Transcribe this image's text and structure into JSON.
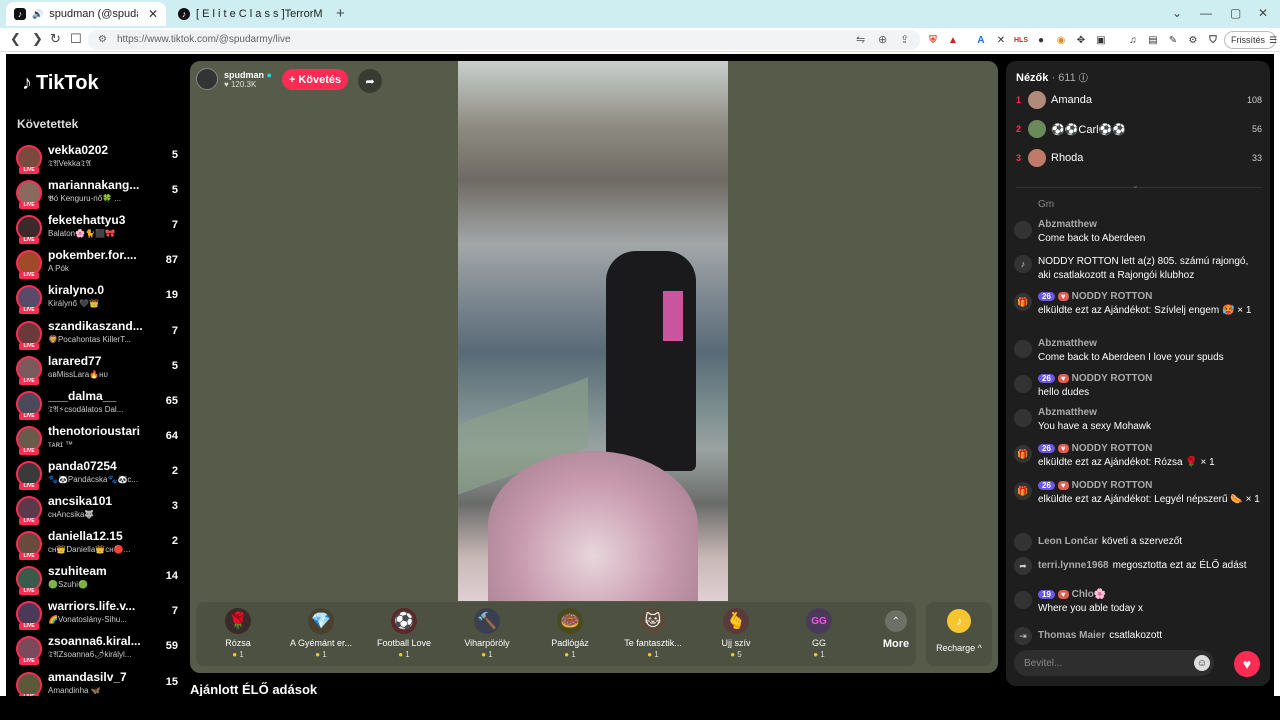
{
  "browser": {
    "tabs": [
      {
        "title": "spudman (@spudarmy) ÉLŐ ...",
        "active": true
      },
      {
        "title": "[ E l i t e  C l a s s ]TerrorMo...",
        "active": false
      }
    ],
    "url": "https://www.tiktok.com/@spudarmy/live",
    "refresh_label": "Frissítés"
  },
  "sidebar": {
    "logo": "TikTok",
    "following_title": "Követettek",
    "live_badge": "LIVE",
    "items": [
      {
        "name": "vekka0202",
        "sub": "𝔗𝔄Vekka𝔗𝔄",
        "count": "5",
        "color": "#7a4a3c"
      },
      {
        "name": "mariannakang...",
        "sub": "𝕭ó Kenguru-nő🍀 ...",
        "count": "5",
        "color": "#8a6a5c"
      },
      {
        "name": "feketehattyu3",
        "sub": "Balaton🌸🐈⬛🎀",
        "count": "7",
        "color": "#3c2a2a"
      },
      {
        "name": "pokember.for....",
        "sub": "A Pók",
        "count": "87",
        "color": "#a04a2a"
      },
      {
        "name": "kiralyno.0",
        "sub": "Királynő 🖤👑",
        "count": "19",
        "color": "#5a4a6a"
      },
      {
        "name": "szandikaszand...",
        "sub": "🦁Pocahontas KillerT...",
        "count": "7",
        "color": "#6a3a3a"
      },
      {
        "name": "larared77",
        "sub": "ɢʙMissLara🔥ʜᴜ",
        "count": "5",
        "color": "#7a5a5a"
      },
      {
        "name": "___dalma__",
        "sub": "𝔗𝔄⚡csodálatos Dal...",
        "count": "65",
        "color": "#4a4a5a"
      },
      {
        "name": "thenotorioustari",
        "sub": "ᴛᴀʀɪ ™",
        "count": "64",
        "color": "#6a5a4a"
      },
      {
        "name": "panda07254",
        "sub": "🐾🐼Pandácska🐾🐼c...",
        "count": "2",
        "color": "#3a3a3a"
      },
      {
        "name": "ancsika101",
        "sub": "ᴄʜAncsika🐺",
        "count": "3",
        "color": "#5a3a4a"
      },
      {
        "name": "daniella12.15",
        "sub": "ᴄʜ👑Daniella👑ᴄʜ🔴...",
        "count": "2",
        "color": "#6a4a3a"
      },
      {
        "name": "szuhiteam",
        "sub": "🟢Szuhi🟢",
        "count": "14",
        "color": "#3a5a4a"
      },
      {
        "name": "warriors.life.v...",
        "sub": "🌈Vonatoslány-Sihu...",
        "count": "7",
        "color": "#4a3a5a"
      },
      {
        "name": "zsoanna6.kiral...",
        "sub": "𝔗𝔄Zsoanna6🌶királyl...",
        "count": "59",
        "color": "#7a4a5a"
      },
      {
        "name": "amandasilv_7",
        "sub": "Amandinha 🦋",
        "count": "15",
        "color": "#5a5a3a"
      }
    ]
  },
  "stage": {
    "host_name": "spudman",
    "host_likes": "120.3K",
    "follow_label": "+ Követés",
    "gifts": [
      {
        "name": "Rózsa",
        "price": "1",
        "icon": "🌹",
        "bg": "#3a2a2a"
      },
      {
        "name": "A Gyémánt er...",
        "price": "1",
        "icon": "💎",
        "bg": "#4a4030"
      },
      {
        "name": "Football Love",
        "price": "1",
        "icon": "⚽",
        "bg": "#5a2a2a"
      },
      {
        "name": "Viharpöröly",
        "price": "1",
        "icon": "🔨",
        "bg": "#3a4050"
      },
      {
        "name": "Padlógáz",
        "price": "1",
        "icon": "🍩",
        "bg": "#4a4a20"
      },
      {
        "name": "Te fantasztik...",
        "price": "1",
        "icon": "🐱",
        "bg": "#5a4a3a"
      },
      {
        "name": "Ujj szív",
        "price": "5",
        "icon": "🫰",
        "bg": "#5a3a3a"
      },
      {
        "name": "GG",
        "price": "1",
        "icon": "GG",
        "bg": "#4a3a5a"
      }
    ],
    "more_label": "More",
    "recharge_label": "Recharge ^",
    "recommended_title": "Ajánlott ÉLŐ adások"
  },
  "rpanel": {
    "viewers_label": "Nézők",
    "viewers_count": "· 611",
    "top_viewers": [
      {
        "rank": "1",
        "name": "Amanda",
        "score": "108",
        "color": "#b08a7a"
      },
      {
        "rank": "2",
        "name": "⚽⚽Carl⚽⚽",
        "score": "56",
        "color": "#6a8a5a"
      },
      {
        "rank": "3",
        "name": "Rhoda",
        "score": "33",
        "color": "#c07a6a"
      }
    ],
    "chat": [
      {
        "type": "partial",
        "text": "Gm"
      },
      {
        "type": "msg",
        "name": "Abzmatthew",
        "text": "Come back to Aberdeen"
      },
      {
        "type": "system",
        "text": "NODDY ROTTON lett a(z) 805. számú rajongó, aki csatlakozott a Rajongói klubhoz"
      },
      {
        "type": "gift",
        "lvl": "26",
        "name": "NODDY ROTTON",
        "text": "elküldte ezt az Ajándékot: Szívlelj engem 🥵 × 1"
      },
      {
        "type": "msg",
        "name": "Abzmatthew",
        "text": "Come back to Aberdeen I love your spuds"
      },
      {
        "type": "msg",
        "lvl": "26",
        "name": "NODDY ROTTON",
        "text": "hello dudes"
      },
      {
        "type": "msg",
        "name": "Abzmatthew",
        "text": "You have a sexy Mohawk"
      },
      {
        "type": "gift",
        "lvl": "26",
        "name": "NODDY ROTTON",
        "text": "elküldte ezt az Ajándékot: Rózsa 🌹 × 1"
      },
      {
        "type": "gift",
        "lvl": "26",
        "name": "NODDY ROTTON",
        "text": "elküldte ezt az Ajándékot: Legyél népszerű 🌭 × 1"
      },
      {
        "type": "inline",
        "name": "Leon Lončar",
        "text": "követi a szervezőt"
      },
      {
        "type": "share",
        "name": "terri.lynne1968",
        "text": "megosztotta ezt az ÉLŐ adást"
      },
      {
        "type": "msg",
        "lvl": "19",
        "name": "Chlo🌸",
        "text": "Where you able today x"
      },
      {
        "type": "join",
        "name": "Thomas Maier",
        "text": "csatlakozott"
      }
    ],
    "input_placeholder": "Bevitel..."
  }
}
